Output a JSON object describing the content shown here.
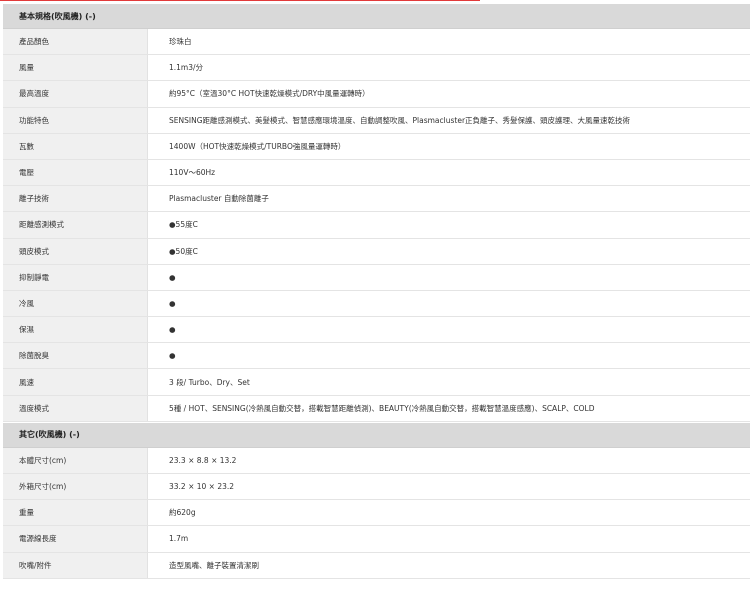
{
  "sections": [
    {
      "title": "基本規格(吹風機) (-)",
      "rows": [
        {
          "label": "產品顏色",
          "value": "珍珠白"
        },
        {
          "label": "風量",
          "value": "1.1m3/分"
        },
        {
          "label": "最高溫度",
          "value": "約95°C（室溫30°C HOT快速乾燥模式/DRY中風量運轉時）"
        },
        {
          "label": "功能特色",
          "value": "SENSING距離感測模式、美髮模式、智慧感應環境溫度、自動調整吹風、Plasmacluster正負離子、秀髮保護、頭皮護理、大風量速乾技術"
        },
        {
          "label": "瓦數",
          "value": "1400W（HOT快速乾燥模式/TURBO強風量運轉時）"
        },
        {
          "label": "電壓",
          "value": "110V～60Hz"
        },
        {
          "label": "離子技術",
          "value": "Plasmacluster 自動除菌離子"
        },
        {
          "label": "距離感測模式",
          "value": "●55度C"
        },
        {
          "label": "頭皮模式",
          "value": "●50度C"
        },
        {
          "label": "抑制靜電",
          "value": "●"
        },
        {
          "label": "冷風",
          "value": "●"
        },
        {
          "label": "保濕",
          "value": "●"
        },
        {
          "label": "除菌脫臭",
          "value": "●"
        },
        {
          "label": "風速",
          "value": "3 段/ Turbo、Dry、Set"
        },
        {
          "label": "溫度模式",
          "value": "5種 / HOT、SENSING(冷熱風自動交替，搭載智慧距離偵測)、BEAUTY(冷熱風自動交替，搭載智慧溫度感應)、SCALP、COLD"
        }
      ]
    },
    {
      "title": "其它(吹風機) (-)",
      "rows": [
        {
          "label": "本體尺寸(cm)",
          "value": "23.3 × 8.8 × 13.2"
        },
        {
          "label": "外箱尺寸(cm)",
          "value": "33.2 × 10 × 23.2"
        },
        {
          "label": "重量",
          "value": "約620g"
        },
        {
          "label": "電源線長度",
          "value": "1.7m"
        },
        {
          "label": "吹嘴/附件",
          "value": "造型風嘴、離子裝置清潔刷"
        }
      ]
    }
  ]
}
